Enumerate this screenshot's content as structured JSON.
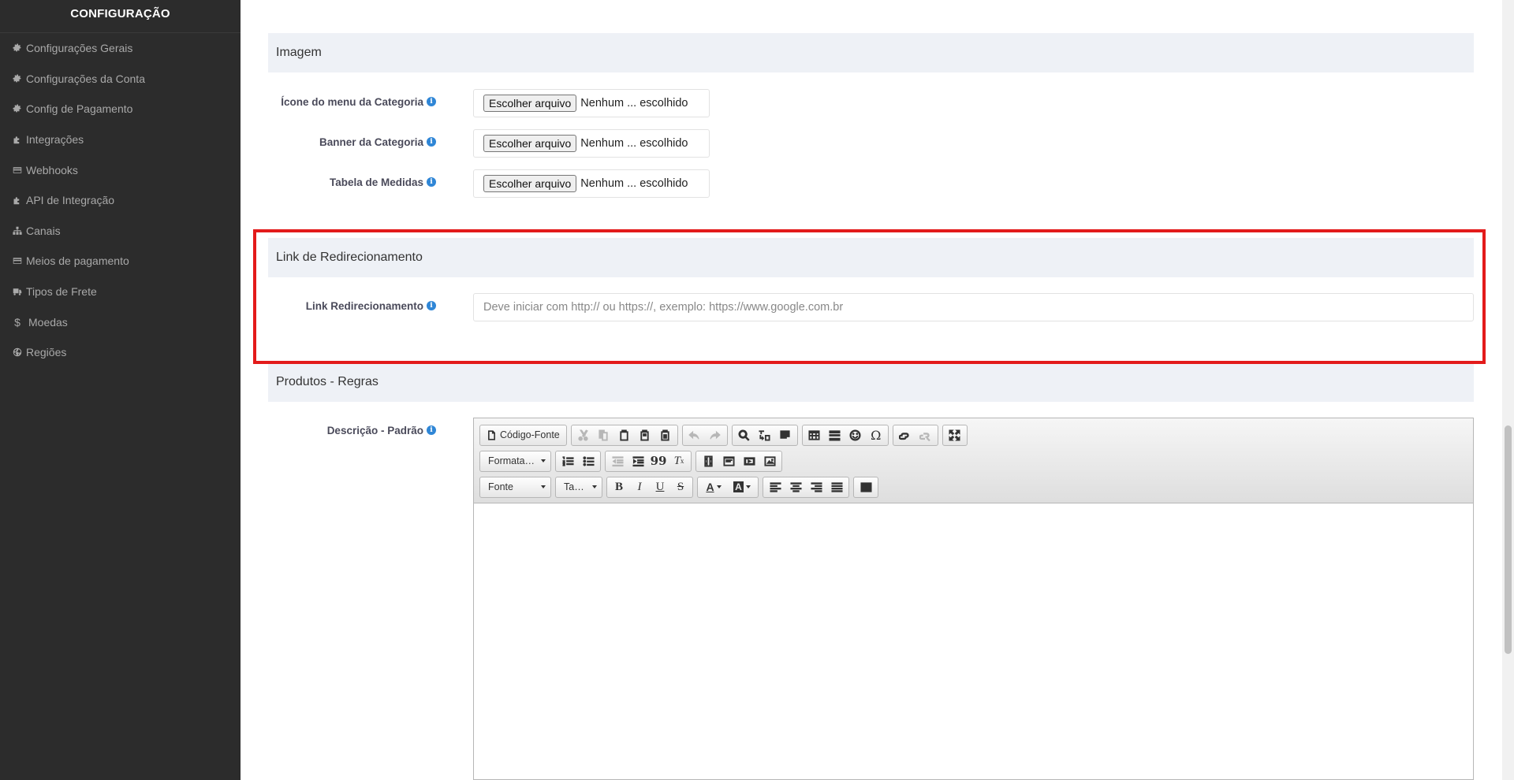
{
  "sidebar": {
    "title": "CONFIGURAÇÃO",
    "items": [
      {
        "label": "Configurações Gerais",
        "icon": "gear-icon"
      },
      {
        "label": "Configurações da Conta",
        "icon": "gear-icon"
      },
      {
        "label": "Config de Pagamento",
        "icon": "gear-icon"
      },
      {
        "label": "Integrações",
        "icon": "puzzle-icon"
      },
      {
        "label": "Webhooks",
        "icon": "credit-card-icon"
      },
      {
        "label": "API de Integração",
        "icon": "puzzle-icon"
      },
      {
        "label": "Canais",
        "icon": "sitemap-icon"
      },
      {
        "label": "Meios de pagamento",
        "icon": "credit-card-icon"
      },
      {
        "label": "Tipos de Frete",
        "icon": "truck-icon"
      },
      {
        "label": "Moedas",
        "icon": "dollar-icon"
      },
      {
        "label": "Regiões",
        "icon": "globe-icon"
      }
    ]
  },
  "image_section": {
    "title": "Imagem",
    "fields": [
      {
        "label": "Ícone do menu da Categoria",
        "button": "Escolher arquivo",
        "status": "Nenhum ... escolhido"
      },
      {
        "label": "Banner da Categoria",
        "button": "Escolher arquivo",
        "status": "Nenhum ... escolhido"
      },
      {
        "label": "Tabela de Medidas",
        "button": "Escolher arquivo",
        "status": "Nenhum ... escolhido"
      }
    ]
  },
  "redirect_section": {
    "title": "Link de Redirecionamento",
    "label": "Link Redirecionamento",
    "placeholder": "Deve iniciar com http:// ou https://, exemplo: https://www.google.com.br",
    "value": ""
  },
  "products_section": {
    "title": "Produtos - Regras",
    "label": "Descrição - Padrão",
    "editor": {
      "source_label": "Código-Fonte",
      "format_combo": "Formata…",
      "font_combo": "Fonte",
      "size_combo": "Ta…",
      "bold": "B",
      "italic": "I",
      "underline": "U",
      "strike": "S",
      "omega": "Ω",
      "quote": "99"
    }
  },
  "colors": {
    "sidebar_bg": "#2c2c2c",
    "section_header_bg": "#eef1f6",
    "highlight": "#e31b1b",
    "info_icon": "#2f86d6"
  }
}
